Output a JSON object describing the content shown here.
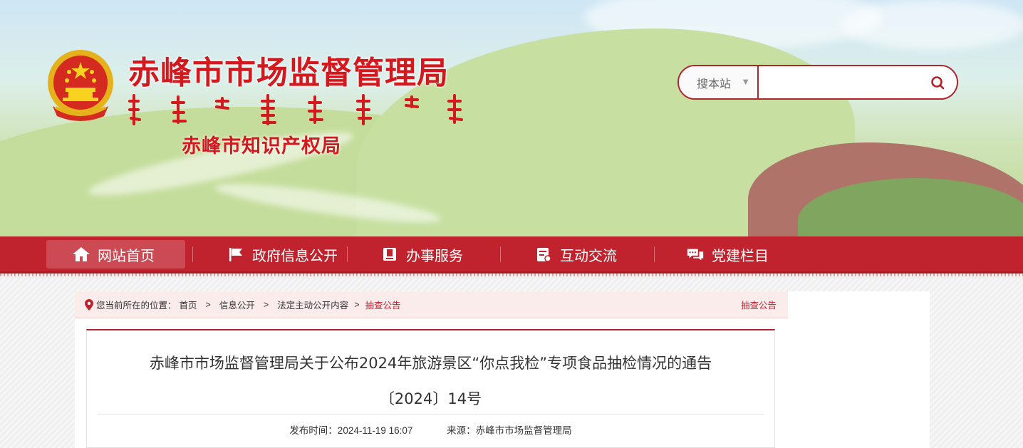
{
  "header": {
    "site_title": "赤峰市市场监督管理局",
    "sub_title": "赤峰市知识产权局"
  },
  "search": {
    "scope_label": "搜本站",
    "placeholder": ""
  },
  "nav": {
    "items": [
      {
        "label": "网站首页",
        "icon": "home-icon"
      },
      {
        "label": "政府信息公开",
        "icon": "flag-icon"
      },
      {
        "label": "办事服务",
        "icon": "book-icon"
      },
      {
        "label": "互动交流",
        "icon": "form-icon"
      },
      {
        "label": "党建栏目",
        "icon": "chat-icon"
      }
    ]
  },
  "breadcrumb": {
    "prefix": "您当前所在的位置：",
    "items": [
      "首页",
      "信息公开",
      "法定主动公开内容",
      "抽查公告"
    ],
    "right_link": "抽查公告"
  },
  "article": {
    "title": "赤峰市市场监督管理局关于公布2024年旅游景区“你点我检”专项食品抽检情况的通告",
    "doc_no": "〔2024〕14号",
    "publish_time": "发布时间：2024-11-19 16:07",
    "source": "来源：赤峰市市场监督管理局"
  },
  "colors": {
    "brand_red": "#c0232e",
    "title_red": "#d3181e"
  }
}
